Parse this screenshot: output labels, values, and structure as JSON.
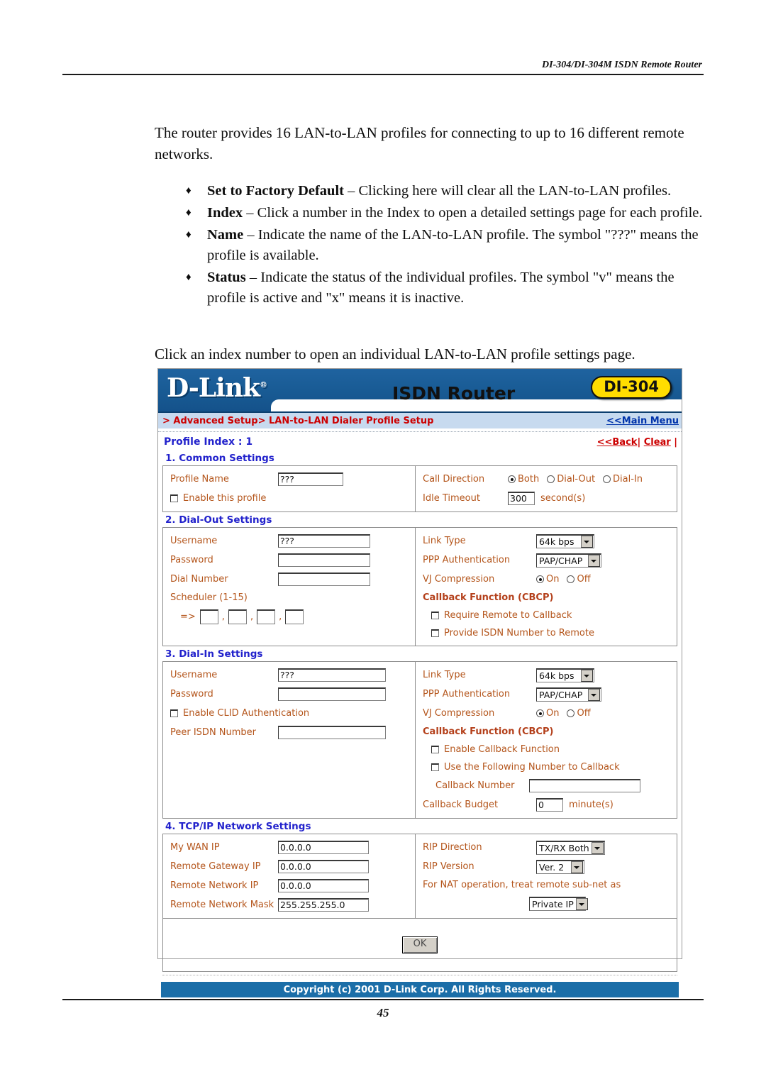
{
  "document": {
    "running_head": "DI-304/DI-304M ISDN Remote Router",
    "page_number": "45",
    "intro": "The router provides 16 LAN-to-LAN profiles for connecting to up to 16 different remote networks.",
    "bullets": [
      {
        "mark": "♦",
        "term": "Set to Factory Default",
        "rest": " – Clicking here will clear all the LAN-to-LAN profiles."
      },
      {
        "mark": "♦",
        "term": "Index",
        "rest": " – Click a number in the Index to open a detailed settings page for each profile."
      },
      {
        "mark": "♦",
        "term": "Name",
        "rest": " – Indicate the name of the LAN-to-LAN profile. The symbol \"???\" means the profile is available."
      },
      {
        "mark": "♦",
        "term": "Status",
        "rest": " – Indicate the status of the individual profiles. The symbol \"v\" means the profile is active and \"x\" means it is inactive."
      }
    ],
    "closing": "Click an index number to open an individual LAN-to-LAN profile settings page."
  },
  "router_ui": {
    "brand": "D-Link",
    "brand_mark": "®",
    "product_title": "ISDN Router",
    "model_badge": "DI-304",
    "breadcrumb": "> Advanced Setup> LAN-to-LAN Dialer Profile Setup",
    "main_menu_link": "<<Main Menu",
    "profile_index_label": "Profile Index : 1",
    "back_link": "<<Back",
    "clear_link": "Clear",
    "sections": {
      "common": {
        "title": "1. Common Settings",
        "profile_name_label": "Profile Name",
        "profile_name_value": "???",
        "enable_profile_label": "Enable this profile",
        "enable_profile_checked": false,
        "call_direction_label": "Call Direction",
        "call_direction_options": [
          "Both",
          "Dial-Out",
          "Dial-In"
        ],
        "call_direction_selected": "Both",
        "idle_timeout_label": "Idle Timeout",
        "idle_timeout_value": "300",
        "idle_timeout_unit": "second(s)"
      },
      "dial_out": {
        "title": "2. Dial-Out Settings",
        "username_label": "Username",
        "username_value": "???",
        "password_label": "Password",
        "password_value": "",
        "dial_number_label": "Dial Number",
        "dial_number_value": "",
        "scheduler_label": "Scheduler (1-15)",
        "scheduler_prefix": "=>",
        "scheduler_values": [
          "",
          "",
          "",
          ""
        ],
        "link_type_label": "Link Type",
        "link_type_value": "64k bps",
        "ppp_auth_label": "PPP Authentication",
        "ppp_auth_value": "PAP/CHAP",
        "vj_label": "VJ Compression",
        "vj_options": [
          "On",
          "Off"
        ],
        "vj_selected": "On",
        "callback_title": "Callback Function (CBCP)",
        "require_remote_label": "Require Remote to Callback",
        "require_remote_checked": false,
        "provide_isdn_label": "Provide ISDN Number to Remote",
        "provide_isdn_checked": false
      },
      "dial_in": {
        "title": "3. Dial-In Settings",
        "username_label": "Username",
        "username_value": "???",
        "password_label": "Password",
        "password_value": "",
        "clid_label": "Enable CLID Authentication",
        "clid_checked": false,
        "peer_isdn_label": "Peer ISDN Number",
        "peer_isdn_value": "",
        "link_type_label": "Link Type",
        "link_type_value": "64k bps",
        "ppp_auth_label": "PPP Authentication",
        "ppp_auth_value": "PAP/CHAP",
        "vj_label": "VJ Compression",
        "vj_options": [
          "On",
          "Off"
        ],
        "vj_selected": "On",
        "callback_title": "Callback Function (CBCP)",
        "enable_callback_label": "Enable Callback Function",
        "enable_callback_checked": false,
        "use_following_label": "Use the Following Number to Callback",
        "use_following_checked": false,
        "callback_number_label": "Callback Number",
        "callback_number_value": "",
        "callback_budget_label": "Callback Budget",
        "callback_budget_value": "0",
        "callback_budget_unit": "minute(s)"
      },
      "tcpip": {
        "title": "4. TCP/IP Network Settings",
        "wan_ip_label": "My WAN IP",
        "wan_ip_value": "0.0.0.0",
        "remote_gw_label": "Remote Gateway IP",
        "remote_gw_value": "0.0.0.0",
        "remote_net_label": "Remote Network IP",
        "remote_net_value": "0.0.0.0",
        "remote_mask_label": "Remote Network Mask",
        "remote_mask_value": "255.255.255.0",
        "rip_direction_label": "RIP Direction",
        "rip_direction_value": "TX/RX Both",
        "rip_version_label": "RIP Version",
        "rip_version_value": "Ver. 2",
        "nat_label": "For NAT operation, treat remote sub-net as",
        "nat_value": "Private IP"
      }
    },
    "ok_button": "OK",
    "copyright": "Copyright (c) 2001 D-Link Corp. All Rights Reserved."
  },
  "colors": {
    "header_blue": "#1b5c96",
    "breadcrumb_blue": "#c7daef",
    "badge_yellow": "#ffdd00",
    "label_orange": "#b4551b",
    "section_blue": "#2222cc",
    "link_red": "#cc0000",
    "copyright_blue": "#1b6ea8"
  }
}
